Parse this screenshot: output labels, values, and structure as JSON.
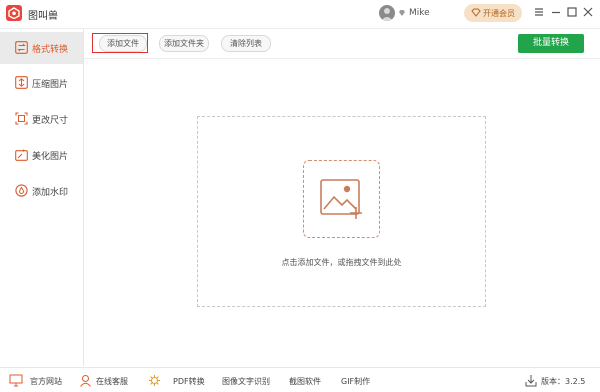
{
  "window": {
    "app_title": "图叫兽",
    "username": "Mike",
    "vip_label": "开通会员"
  },
  "sidebar": {
    "items": [
      {
        "label": "格式转换",
        "active": true
      },
      {
        "label": "压缩图片",
        "active": false
      },
      {
        "label": "更改尺寸",
        "active": false
      },
      {
        "label": "美化图片",
        "active": false
      },
      {
        "label": "添加水印",
        "active": false
      }
    ]
  },
  "toolbar": {
    "add_file": "添加文件",
    "add_folder": "添加文件夹",
    "clear_list": "清除列表",
    "batch_convert": "批量转换"
  },
  "dropzone": {
    "hint": "点击添加文件，或拖拽文件到此处"
  },
  "footer": {
    "website": "官方网站",
    "support": "在线客服",
    "pdf": "PDF转换",
    "ocr": "图像文字识别",
    "screenshot": "截图软件",
    "gif": "GIF制作",
    "version": "版本：3.2.5"
  },
  "colors": {
    "accent": "#e05a2b",
    "brand": "#e8453c",
    "primary_button": "#22a44a",
    "vip_bg": "#f6e0c6"
  }
}
